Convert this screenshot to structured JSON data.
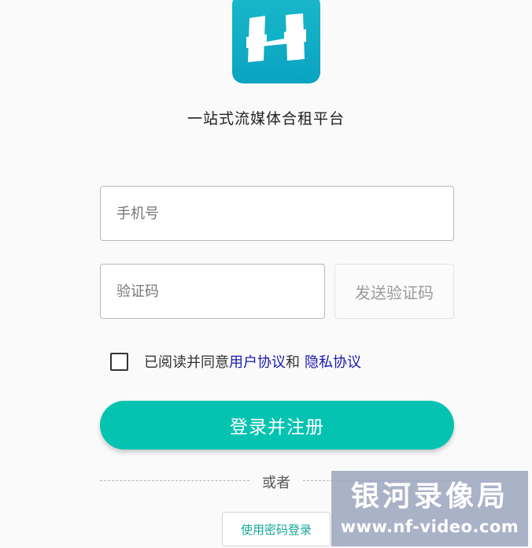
{
  "brand": {
    "logo_icon": "h-logo-icon",
    "logo_color": "#0aa3c2",
    "tagline": "一站式流媒体合租平台"
  },
  "form": {
    "phone_placeholder": "手机号",
    "code_placeholder": "验证码",
    "send_code_label": "发送验证码",
    "agreement": {
      "prefix": "已阅读并同意",
      "user_agreement": "用户协议",
      "conjunction": "和",
      "privacy_policy": "隐私协议",
      "checked": false
    },
    "submit_label": "登录并注册",
    "submit_color": "#04c3b1"
  },
  "alt_login": {
    "divider_text": "或者",
    "password_login_label": "使用密码登录"
  },
  "watermark": {
    "title": "银河录像局",
    "url": "www.nf-video.com"
  }
}
